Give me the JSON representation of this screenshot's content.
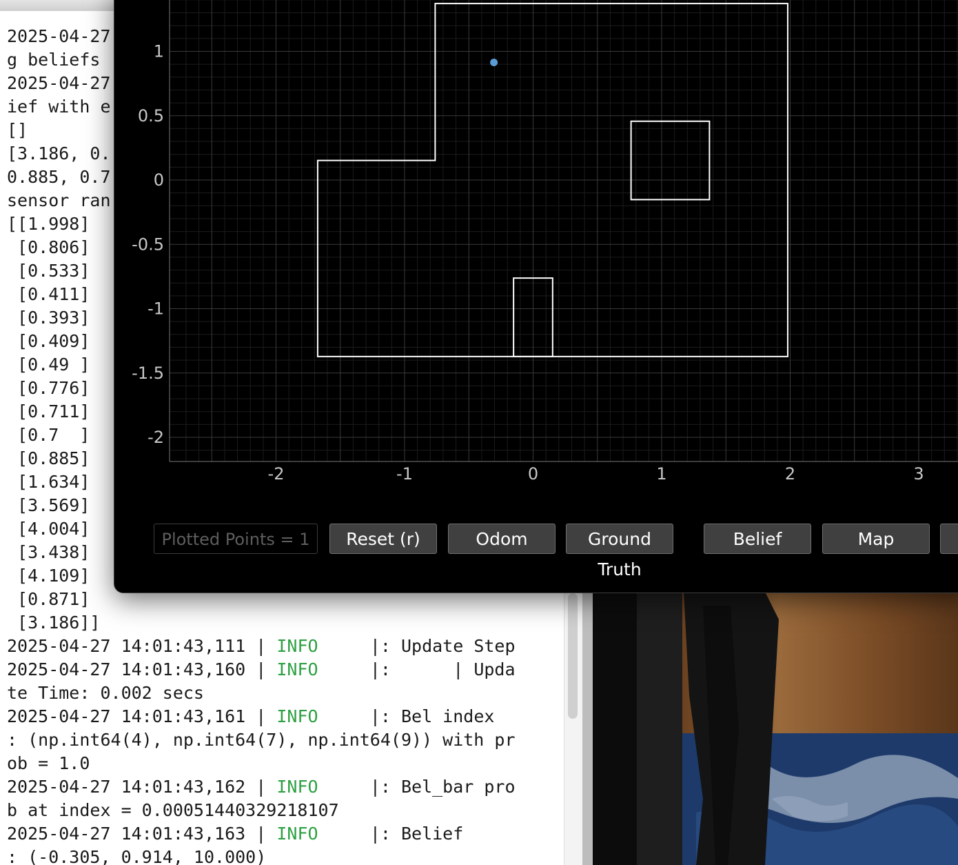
{
  "terminal": {
    "lines_upper": [
      "2025-04-27",
      "g beliefs",
      "2025-04-27",
      "ief with e",
      "[]",
      "[3.186, 0.",
      "0.885, 0.7",
      "sensor ran",
      "[[1.998]",
      " [0.806]",
      " [0.533]",
      " [0.411]",
      " [0.393]",
      " [0.409]",
      " [0.49 ]",
      " [0.776]",
      " [0.711]",
      " [0.7  ]",
      " [0.885]",
      " [1.634]",
      " [3.569]",
      " [4.004]",
      " [3.438]",
      " [4.109]",
      " [0.871]",
      " [3.186]]"
    ],
    "log_lines": [
      {
        "pre": "2025-04-27 14:01:43,111 | ",
        "level": "INFO",
        "post": "     |: Update Step"
      },
      {
        "pre": "2025-04-27 14:01:43,160 | ",
        "level": "INFO",
        "post": "     |:      | Upda"
      },
      {
        "pre": "te Time: 0.002 secs",
        "level": "",
        "post": ""
      },
      {
        "pre": "2025-04-27 14:01:43,161 | ",
        "level": "INFO",
        "post": "     |: Bel index"
      },
      {
        "pre": ": (np.int64(4), np.int64(7), np.int64(9)) with pr",
        "level": "",
        "post": ""
      },
      {
        "pre": "ob = 1.0",
        "level": "",
        "post": ""
      },
      {
        "pre": "2025-04-27 14:01:43,162 | ",
        "level": "INFO",
        "post": "     |: Bel_bar pro"
      },
      {
        "pre": "b at index = 0.00051440329218107",
        "level": "",
        "post": ""
      },
      {
        "pre": "2025-04-27 14:01:43,163 | ",
        "level": "INFO",
        "post": "     |: Belief"
      },
      {
        "pre": ": (-0.305, 0.914, 10.000)",
        "level": "",
        "post": ""
      }
    ]
  },
  "plotter": {
    "plotted_points": "Plotted Points = 1",
    "buttons": {
      "reset": "Reset (r)",
      "odom": "Odom",
      "ground_truth": "Ground Truth",
      "belief": "Belief",
      "map": "Map"
    },
    "colors": {
      "background": "#000000",
      "map_lines": "#ffffff",
      "belief_point": "#5b9bd5",
      "grid": "#2a2a2a"
    }
  },
  "chart_data": {
    "type": "scatter",
    "title": "",
    "xlabel": "",
    "ylabel": "",
    "xlim": [
      -2.8,
      3.35
    ],
    "ylim": [
      -2.2,
      1.5
    ],
    "x_ticks": [
      -2,
      -1,
      0,
      1,
      2,
      3
    ],
    "y_ticks": [
      1,
      0.5,
      0,
      -0.5,
      -1,
      -1.5,
      -2
    ],
    "x_tick_labels": [
      "-2",
      "-1",
      "0",
      "1",
      "2",
      "3"
    ],
    "y_tick_labels": [
      "1",
      "0.5",
      "0",
      "-0.5",
      "-1",
      "-1.5",
      "-2"
    ],
    "grid": true,
    "series": [
      {
        "points": [
          [
            -0.305,
            0.914
          ]
        ],
        "color": "#5b9bd5"
      }
    ],
    "map": {
      "outer_polygon": [
        [
          -1.676,
          -1.372
        ],
        [
          1.981,
          -1.372
        ],
        [
          1.981,
          1.372
        ],
        [
          -0.762,
          1.372
        ],
        [
          -0.762,
          0.152
        ],
        [
          -1.676,
          0.152
        ]
      ],
      "box_obstacle": [
        [
          0.762,
          -0.152
        ],
        [
          1.372,
          -0.152
        ],
        [
          1.372,
          0.457
        ],
        [
          0.762,
          0.457
        ]
      ],
      "small_obstacle": [
        [
          -0.152,
          -1.372
        ],
        [
          0.152,
          -1.372
        ],
        [
          0.152,
          -0.762
        ],
        [
          -0.152,
          -0.762
        ]
      ]
    }
  }
}
